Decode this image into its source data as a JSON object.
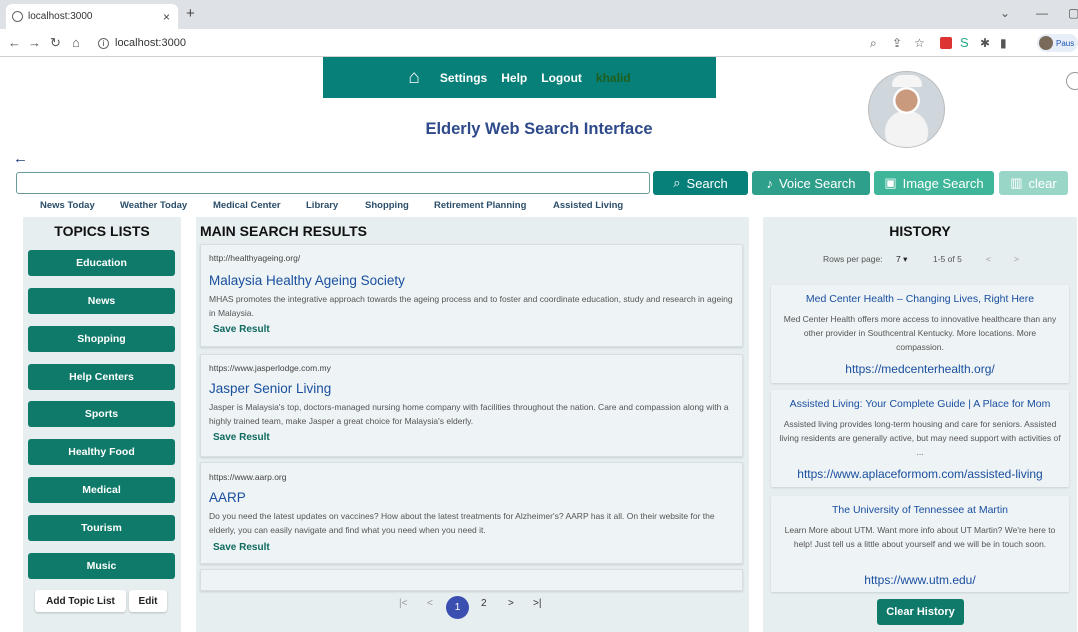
{
  "browser": {
    "tab_title": "localhost:3000",
    "tab_close": "×",
    "new_tab": "+",
    "url": "localhost:3000",
    "profile_label": "Paus"
  },
  "nav": {
    "home_icon": "⌂",
    "settings": "Settings",
    "help": "Help",
    "logout": "Logout",
    "username": "khalid"
  },
  "app_title": "Elderly Web Search Interface",
  "search": {
    "value": "",
    "search_label": "Search",
    "voice_label": "Voice Search",
    "image_label": "Image Search",
    "clear_label": "clear"
  },
  "quick_links": [
    "News Today",
    "Weather Today",
    "Medical Center",
    "Library",
    "Shopping",
    "Retirement Planning",
    "Assisted Living"
  ],
  "topics": {
    "heading": "TOPICS LISTS",
    "items": [
      "Education",
      "News",
      "Shopping",
      "Help Centers",
      "Sports",
      "Healthy Food",
      "Medical",
      "Tourism",
      "Music"
    ],
    "add_label": "Add Topic List",
    "edit_label": "Edit"
  },
  "results": {
    "heading": "MAIN SEARCH RESULTS",
    "save_label": "Save Result",
    "items": [
      {
        "url": "http://healthyageing.org/",
        "title": "Malaysia Healthy Ageing Society",
        "desc": "MHAS promotes the integrative approach towards the ageing process and to foster and coordinate education, study and research in ageing in Malaysia."
      },
      {
        "url": "https://www.jasperlodge.com.my",
        "title": "Jasper Senior Living",
        "desc": "Jasper is Malaysia's top, doctors-managed nursing home company with facilities throughout the nation. Care and compassion along with a highly trained team, make Jasper a great choice for Malaysia's elderly."
      },
      {
        "url": "https://www.aarp.org",
        "title": "AARP",
        "desc": "Do you need the latest updates on vaccines? How about the latest treatments for Alzheimer's? AARP has it all. On their website for the elderly, you can easily navigate and find what you need when you need it."
      }
    ],
    "pagination": {
      "first": "|<",
      "prev": "<",
      "current": "1",
      "next_page": "2",
      "next": ">",
      "last": ">|"
    }
  },
  "history": {
    "heading": "HISTORY",
    "rows_per_page_label": "Rows per page:",
    "rows_per_page_value": "7",
    "range": "1-5 of 5",
    "prev": "<",
    "next": ">",
    "items": [
      {
        "title": "Med Center Health – Changing Lives, Right Here",
        "desc": "Med Center Health offers more access to innovative healthcare than any other provider in Southcentral Kentucky. More locations. More compassion.",
        "url": "https://medcenterhealth.org/"
      },
      {
        "title": "Assisted Living: Your Complete Guide | A Place for Mom",
        "desc": "Assisted living provides long-term housing and care for seniors. Assisted living residents are generally active, but may need support with activities of ...",
        "url": "https://www.aplaceformom.com/assisted-living"
      },
      {
        "title": "The University of Tennessee at Martin",
        "desc": "Learn More about UTM. Want more info about UT Martin? We're here to help! Just tell us a little about yourself and we will be in touch soon.",
        "url": "https://www.utm.edu/"
      }
    ],
    "clear_label": "Clear History"
  }
}
